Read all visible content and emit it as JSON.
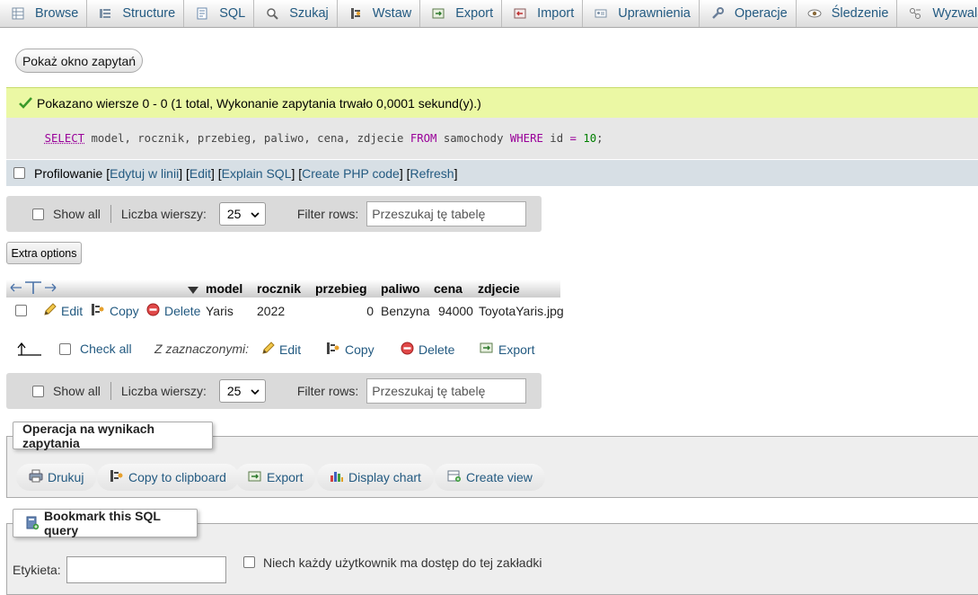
{
  "tabs": [
    {
      "label": "Browse",
      "icon": "browse-icon"
    },
    {
      "label": "Structure",
      "icon": "structure-icon"
    },
    {
      "label": "SQL",
      "icon": "sql-icon"
    },
    {
      "label": "Szukaj",
      "icon": "search-icon"
    },
    {
      "label": "Wstaw",
      "icon": "insert-icon"
    },
    {
      "label": "Export",
      "icon": "export-icon"
    },
    {
      "label": "Import",
      "icon": "import-icon"
    },
    {
      "label": "Uprawnienia",
      "icon": "privileges-icon"
    },
    {
      "label": "Operacje",
      "icon": "wrench-icon"
    },
    {
      "label": "Śledzenie",
      "icon": "eye-icon"
    },
    {
      "label": "Wyzwalacze",
      "icon": "triggers-icon"
    }
  ],
  "query_window_button": "Pokaż okno zapytań",
  "success_message": "Pokazano wiersze 0 - 0 (1 total, Wykonanie zapytania trwało 0,0001 sekund(y).)",
  "sql": {
    "select": "SELECT",
    "columns": " model, rocznik, przebieg, paliwo, cena, zdjecie ",
    "from": "FROM",
    "table": " samochody ",
    "where": "WHERE",
    "col": " id ",
    "op": "=",
    "value": " 10",
    "end": ";"
  },
  "profiling": {
    "label": "Profilowanie",
    "links": [
      "Edytuj w linii",
      "Edit",
      "Explain SQL",
      "Create PHP code",
      "Refresh"
    ]
  },
  "navbar": {
    "show_all": "Show all",
    "rows_label": "Liczba wierszy:",
    "rows_value": "25",
    "filter_label": "Filter rows:",
    "filter_placeholder": "Przeszukaj tę tabelę"
  },
  "extra_options": "Extra options",
  "table": {
    "columns": [
      "model",
      "rocznik",
      "przebieg",
      "paliwo",
      "cena",
      "zdjecie"
    ],
    "row_actions": {
      "edit": "Edit",
      "copy": "Copy",
      "delete": "Delete"
    },
    "rows": [
      {
        "model": "Yaris",
        "rocznik": "2022",
        "przebieg": "0",
        "paliwo": "Benzyna",
        "cena": "94000",
        "zdjecie": "ToyotaYaris.jpg"
      }
    ]
  },
  "bulk": {
    "check_all": "Check all",
    "with_selected": "Z zaznaczonymi:",
    "edit": "Edit",
    "copy": "Copy",
    "delete": "Delete",
    "export": "Export"
  },
  "query_results_ops": {
    "legend": "Operacja na wynikach zapytania",
    "buttons": [
      "Drukuj",
      "Copy to clipboard",
      "Export",
      "Display chart",
      "Create view"
    ]
  },
  "bookmark": {
    "legend": "Bookmark this SQL query",
    "label": "Etykieta:",
    "shared_label": "Niech każdy użytkownik ma dostęp do tej zakładki"
  },
  "colors": {
    "link": "#235a81",
    "success_bg": "#ebf8a4",
    "keyword": "#990099",
    "number": "#008000"
  }
}
